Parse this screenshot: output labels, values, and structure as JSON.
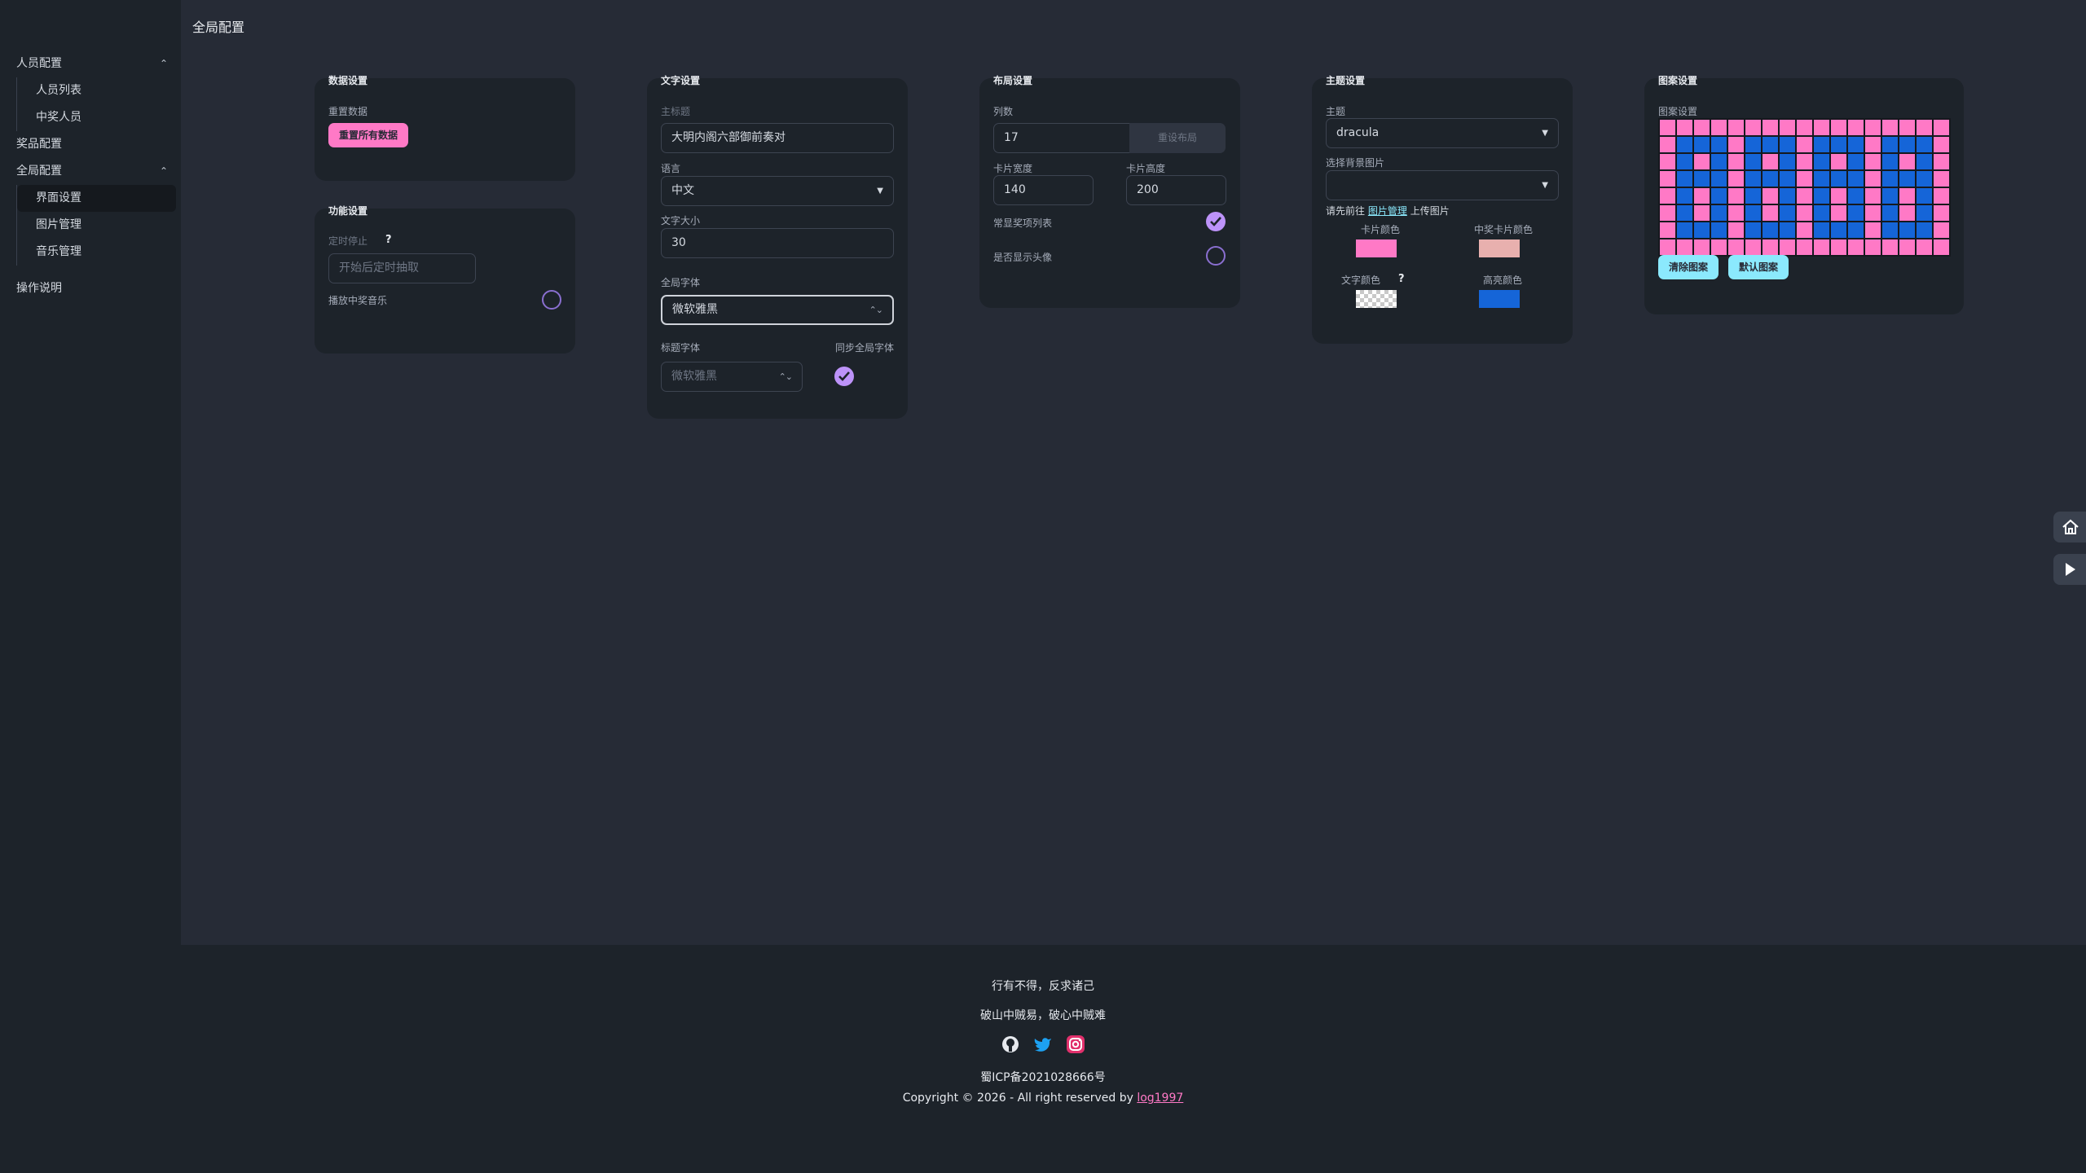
{
  "page": {
    "title": "全局配置"
  },
  "sidebar": {
    "groups": [
      {
        "label": "人员配置",
        "expanded": true,
        "items": [
          "人员列表",
          "中奖人员"
        ]
      },
      {
        "label": "奖品配置"
      },
      {
        "label": "全局配置",
        "expanded": true,
        "items": [
          "界面设置",
          "图片管理",
          "音乐管理"
        ],
        "active": "界面设置"
      },
      {
        "label": "操作说明"
      }
    ]
  },
  "data_settings": {
    "title": "数据设置",
    "reset_label": "重置数据",
    "reset_button": "重置所有数据"
  },
  "function_settings": {
    "title": "功能设置",
    "timer_label": "定时停止",
    "timer_placeholder": "开始后定时抽取",
    "music_label": "播放中奖音乐",
    "music_enabled": false
  },
  "text_settings": {
    "title": "文字设置",
    "main_title_label": "主标题",
    "main_title_value": "大明内阁六部御前奏对",
    "language_label": "语言",
    "language_value": "中文",
    "font_size_label": "文字大小",
    "font_size_value": "30",
    "global_font_label": "全局字体",
    "global_font_value": "微软雅黑",
    "title_font_label": "标题字体",
    "title_font_value": "微软雅黑",
    "sync_font_label": "同步全局字体",
    "sync_font_enabled": true
  },
  "layout_settings": {
    "title": "布局设置",
    "columns_label": "列数",
    "columns_value": "17",
    "reset_layout_button": "重设布局",
    "card_width_label": "卡片宽度",
    "card_width_value": "140",
    "card_height_label": "卡片高度",
    "card_height_value": "200",
    "show_prize_list_label": "常显奖项列表",
    "show_prize_list": true,
    "show_avatar_label": "是否显示头像",
    "show_avatar": false
  },
  "theme_settings": {
    "title": "主题设置",
    "theme_label": "主题",
    "theme_value": "dracula",
    "bg_image_label": "选择背景图片",
    "bg_image_value": "",
    "hint_prefix": "请先前往",
    "hint_link": "图片管理",
    "hint_suffix": "上传图片",
    "card_color_label": "卡片颜色",
    "card_color": "#ff79c6",
    "win_card_color_label": "中奖卡片颜色",
    "win_card_color": "#e8b0ae",
    "text_color_label": "文字颜色",
    "text_color": "transparent",
    "highlight_color_label": "高亮颜色",
    "highlight_color": "#1565d8"
  },
  "pattern_settings": {
    "title": "图案设置",
    "label": "图案设置",
    "columns": 17,
    "rows": 8,
    "base_color": "#ff79c6",
    "highlight_color": "#1565d8",
    "highlight_cells": [
      [
        1,
        1
      ],
      [
        1,
        2
      ],
      [
        1,
        3
      ],
      [
        1,
        5
      ],
      [
        1,
        6
      ],
      [
        1,
        7
      ],
      [
        1,
        9
      ],
      [
        1,
        10
      ],
      [
        1,
        11
      ],
      [
        1,
        13
      ],
      [
        1,
        14
      ],
      [
        1,
        15
      ],
      [
        2,
        1
      ],
      [
        2,
        3
      ],
      [
        2,
        5
      ],
      [
        2,
        7
      ],
      [
        2,
        9
      ],
      [
        2,
        11
      ],
      [
        2,
        13
      ],
      [
        2,
        15
      ],
      [
        3,
        1
      ],
      [
        3,
        2
      ],
      [
        3,
        3
      ],
      [
        3,
        5
      ],
      [
        3,
        6
      ],
      [
        3,
        7
      ],
      [
        3,
        9
      ],
      [
        3,
        10
      ],
      [
        3,
        11
      ],
      [
        3,
        13
      ],
      [
        3,
        14
      ],
      [
        3,
        15
      ],
      [
        4,
        1
      ],
      [
        4,
        3
      ],
      [
        4,
        5
      ],
      [
        4,
        7
      ],
      [
        4,
        9
      ],
      [
        4,
        11
      ],
      [
        4,
        13
      ],
      [
        4,
        15
      ],
      [
        5,
        1
      ],
      [
        5,
        3
      ],
      [
        5,
        5
      ],
      [
        5,
        7
      ],
      [
        5,
        9
      ],
      [
        5,
        11
      ],
      [
        5,
        13
      ],
      [
        5,
        15
      ],
      [
        6,
        1
      ],
      [
        6,
        2
      ],
      [
        6,
        3
      ],
      [
        6,
        5
      ],
      [
        6,
        6
      ],
      [
        6,
        7
      ],
      [
        6,
        9
      ],
      [
        6,
        10
      ],
      [
        6,
        11
      ],
      [
        6,
        13
      ],
      [
        6,
        14
      ],
      [
        6,
        15
      ]
    ],
    "clear_button": "清除图案",
    "default_button": "默认图案"
  },
  "footer": {
    "motto1": "行有不得，反求诸己",
    "motto2": "破山中贼易，破心中贼难",
    "icons": [
      "github-icon",
      "twitter-icon",
      "instagram-icon"
    ],
    "icp": "蜀ICP备2021028666号",
    "copyright_prefix": "Copyright © 2026 - All right reserved by",
    "copyright_link": "log1997"
  },
  "floating": {
    "icons": [
      "home-icon",
      "play-icon"
    ]
  }
}
